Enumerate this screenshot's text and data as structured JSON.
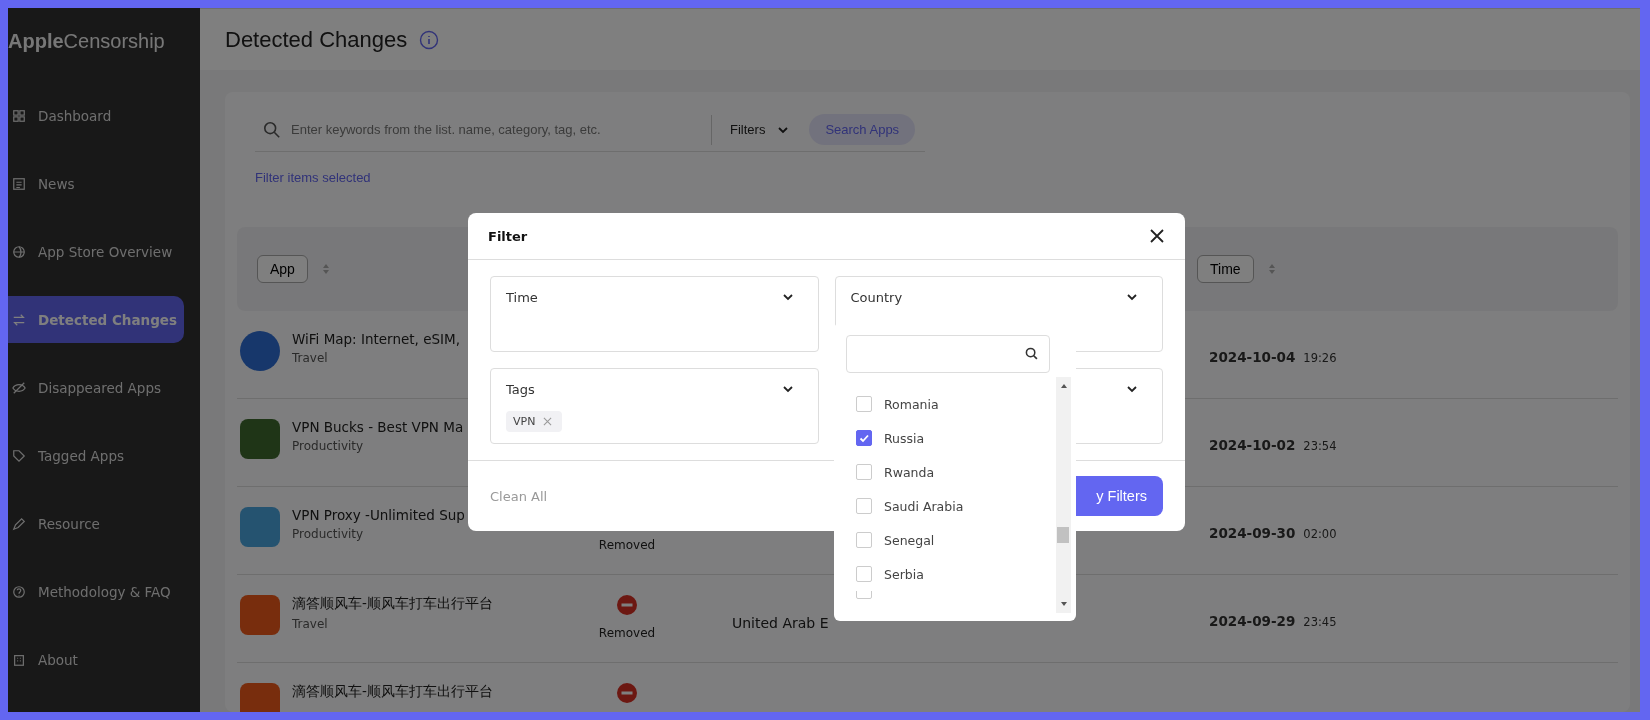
{
  "logo": "**Apple**Censorship",
  "sidebar": {
    "items": [
      {
        "label": "Dashboard",
        "selected": false
      },
      {
        "label": "News",
        "selected": false
      },
      {
        "label": "App Store Overview",
        "selected": false
      },
      {
        "label": "Detected Changes",
        "selected": true
      },
      {
        "label": "Disappeared Apps",
        "selected": false
      },
      {
        "label": "Tagged Apps",
        "selected": false
      },
      {
        "label": "Resource",
        "selected": false
      },
      {
        "label": "Methodology & FAQ",
        "selected": false
      },
      {
        "label": "About",
        "selected": false
      }
    ]
  },
  "page": {
    "title": "Detected Changes"
  },
  "search": {
    "placeholder": "Enter keywords from the list. name, category, tag, etc.",
    "filters_label": "Filters",
    "button": "Search Apps",
    "filter_note": "Filter items selected"
  },
  "table": {
    "columns": [
      {
        "label": "App",
        "kind": "app"
      },
      {
        "label": "Time",
        "kind": "time"
      }
    ],
    "rows": [
      {
        "name": "WiFi Map: Internet, eSIM,",
        "category": "Travel",
        "date": "2024-10-04",
        "time": "19:26"
      },
      {
        "name": "VPN Bucks - Best VPN Ma",
        "category": "Productivity",
        "date": "2024-10-02",
        "time": "23:54"
      },
      {
        "name": "VPN Proxy -Unlimited Sup",
        "category": "Productivity",
        "status": "Removed",
        "date": "2024-09-30",
        "time": "02:00"
      },
      {
        "name": "滴答顺风车-顺风车打车出行平台",
        "category": "Travel",
        "status_icon": true,
        "status": "Removed",
        "country": "United Arab E",
        "date": "2024-09-29",
        "time": "23:45"
      },
      {
        "name": "滴答顺风车-顺风车打车出行平台",
        "status_icon": true
      }
    ]
  },
  "modal": {
    "title": "Filter",
    "selects": [
      {
        "kind": "select",
        "label": "Time"
      },
      {
        "kind": "select",
        "label": "Country"
      },
      {
        "kind": "select",
        "label": "Tags",
        "chips": [
          "VPN"
        ]
      },
      {
        "kind": "select"
      }
    ],
    "clear": "Clean All",
    "apply": "y Filters"
  },
  "dropdown": {
    "options": [
      {
        "label": "Romania",
        "checked": false
      },
      {
        "label": "Russia",
        "checked": true
      },
      {
        "label": "Rwanda",
        "checked": false
      },
      {
        "label": "Saudi Arabia",
        "checked": false
      },
      {
        "label": "Senegal",
        "checked": false
      },
      {
        "label": "Serbia",
        "checked": false
      },
      {
        "checked": false
      }
    ]
  }
}
